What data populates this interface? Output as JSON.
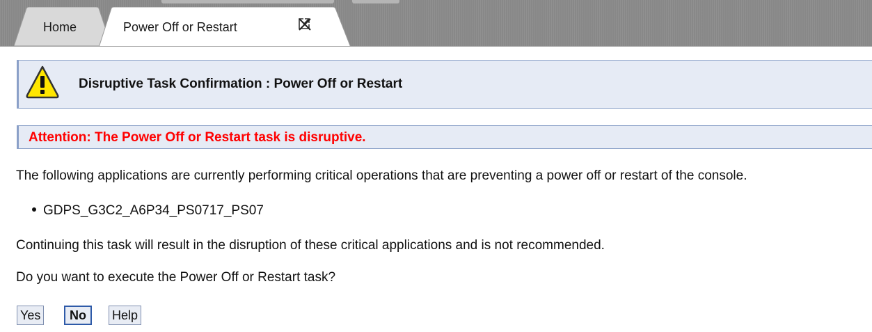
{
  "tabs": [
    {
      "label": "Home",
      "active": false
    },
    {
      "label": "Power Off or Restart",
      "active": true
    }
  ],
  "tab_icons": [
    "external-launch-icon",
    "close-icon"
  ],
  "banner": {
    "icon": "warning-icon",
    "title": "Disruptive Task Confirmation : Power Off or Restart"
  },
  "attention": {
    "label": "Attention:",
    "message": "The Power Off or Restart task is disruptive."
  },
  "body": {
    "intro": "The following applications are currently performing critical operations that are preventing a power off or restart of the console.",
    "applications": [
      "GDPS_G3C2_A6P34_PS0717_PS07"
    ],
    "warning": "Continuing this task will result in the disruption of these critical applications and is not recommended.",
    "question": "Do you want to execute the Power Off or Restart task?"
  },
  "buttons": {
    "yes": "Yes",
    "no": "No",
    "help": "Help"
  },
  "colors": {
    "tabbar": "#8c8c8c",
    "banner_bg": "#e6ebf5",
    "banner_border": "#8aa0c8",
    "attention_text": "#ff0000",
    "default_button_border": "#2e5aa8"
  }
}
